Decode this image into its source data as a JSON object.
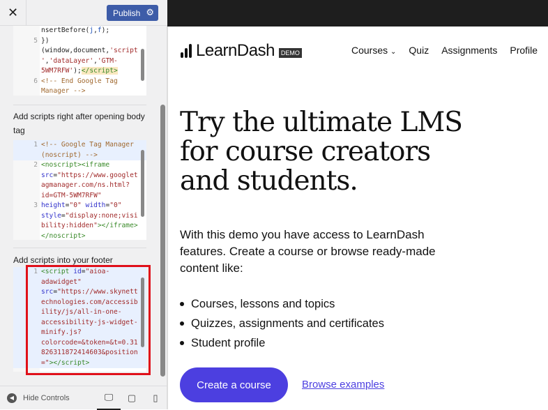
{
  "customizer": {
    "close_icon": "close-icon",
    "publish_label": "Publish",
    "sections": [
      {
        "label": ""
      },
      {
        "label": "Add scripts right after opening body tag"
      },
      {
        "label": "Add scripts into your footer"
      }
    ],
    "code_blocks": [
      {
        "rows": [
          {
            "ln": "",
            "hl": false,
            "t": [
              [
                "nsertBefore(",
                "df"
              ],
              [
                "j",
                "vr"
              ],
              [
                ",",
                "df"
              ],
              [
                "f",
                "vr"
              ],
              [
                ");",
                "df"
              ]
            ]
          },
          {
            "ln": "5",
            "hl": false,
            "t": [
              [
                "})",
                "df"
              ]
            ]
          },
          {
            "ln": "",
            "hl": false,
            "t": [
              [
                "(window,document,",
                "df"
              ],
              [
                "'script",
                "st"
              ]
            ]
          },
          {
            "ln": "",
            "hl": false,
            "t": [
              [
                "'",
                "st"
              ],
              [
                ",",
                "df"
              ],
              [
                "'dataLayer'",
                "st"
              ],
              [
                ",",
                "df"
              ],
              [
                "'GTM-",
                "st"
              ]
            ]
          },
          {
            "ln": "",
            "hl": false,
            "t": [
              [
                "5WM7RFW'",
                "st"
              ],
              [
                ");",
                "df"
              ],
              [
                "</script>",
                "mt"
              ]
            ]
          },
          {
            "ln": "6",
            "hl": false,
            "t": [
              [
                "<!-- End Google Tag",
                "cm"
              ]
            ]
          },
          {
            "ln": "",
            "hl": false,
            "t": [
              [
                "Manager -->",
                "cm"
              ]
            ]
          }
        ]
      },
      {
        "rows": [
          {
            "ln": "1",
            "hl": true,
            "t": [
              [
                "<!-- Google Tag Manager",
                "cm"
              ]
            ]
          },
          {
            "ln": "",
            "hl": true,
            "t": [
              [
                "(noscript) -->",
                "cm"
              ]
            ]
          },
          {
            "ln": "2",
            "hl": false,
            "t": [
              [
                "<noscript><iframe",
                "tg"
              ]
            ]
          },
          {
            "ln": "",
            "hl": false,
            "t": [
              [
                "src",
                "at"
              ],
              [
                "=",
                "df"
              ],
              [
                "\"https://www.googlet",
                "st"
              ]
            ]
          },
          {
            "ln": "",
            "hl": false,
            "t": [
              [
                "agmanager.com/ns.html?",
                "st"
              ]
            ]
          },
          {
            "ln": "",
            "hl": false,
            "t": [
              [
                "id=GTM-5WM7RFW\"",
                "st"
              ]
            ]
          },
          {
            "ln": "3",
            "hl": false,
            "t": [
              [
                "height",
                "at"
              ],
              [
                "=",
                "df"
              ],
              [
                "\"0\"",
                "st"
              ],
              [
                " ",
                "df"
              ],
              [
                "width",
                "at"
              ],
              [
                "=",
                "df"
              ],
              [
                "\"0\"",
                "st"
              ]
            ]
          },
          {
            "ln": "",
            "hl": false,
            "t": [
              [
                "style",
                "at"
              ],
              [
                "=",
                "df"
              ],
              [
                "\"display:none;visi",
                "st"
              ]
            ]
          },
          {
            "ln": "",
            "hl": false,
            "t": [
              [
                "bility:hidden\"",
                "st"
              ],
              [
                "></iframe>",
                "tg"
              ]
            ]
          },
          {
            "ln": "",
            "hl": false,
            "t": [
              [
                "</noscript>",
                "tg"
              ]
            ]
          }
        ]
      },
      {
        "rows": [
          {
            "ln": "1",
            "hl": true,
            "t": [
              [
                "<script ",
                "tg"
              ],
              [
                "id",
                "at"
              ],
              [
                "=",
                "df"
              ],
              [
                "\"aioa-",
                "st"
              ]
            ]
          },
          {
            "ln": "",
            "hl": true,
            "t": [
              [
                "adawidget\"",
                "st"
              ]
            ]
          },
          {
            "ln": "",
            "hl": true,
            "t": [
              [
                "src",
                "at"
              ],
              [
                "=",
                "df"
              ],
              [
                "\"https://www.skynett",
                "st"
              ]
            ]
          },
          {
            "ln": "",
            "hl": true,
            "t": [
              [
                "echnologies.com/accessib",
                "st"
              ]
            ]
          },
          {
            "ln": "",
            "hl": true,
            "t": [
              [
                "ility/js/all-in-one-",
                "st"
              ]
            ]
          },
          {
            "ln": "",
            "hl": true,
            "t": [
              [
                "accessibility-js-widget-",
                "st"
              ]
            ]
          },
          {
            "ln": "",
            "hl": true,
            "t": [
              [
                "minify.js?",
                "st"
              ]
            ]
          },
          {
            "ln": "",
            "hl": true,
            "t": [
              [
                "colorcode=&token=&t=0.31",
                "st"
              ]
            ]
          },
          {
            "ln": "",
            "hl": true,
            "t": [
              [
                "826311872414603&position",
                "st"
              ]
            ]
          },
          {
            "ln": "",
            "hl": true,
            "t": [
              [
                "=\"",
                "st"
              ],
              [
                "></script>",
                "tg"
              ]
            ]
          }
        ]
      }
    ],
    "hide_controls_label": "Hide Controls",
    "devices": [
      "desktop",
      "tablet",
      "mobile"
    ]
  },
  "site": {
    "logo_text": "LearnDash",
    "logo_badge": "DEMO",
    "nav": [
      "Courses",
      "Quiz",
      "Assignments",
      "Profile"
    ],
    "hero_title": "Try the ultimate LMS for course creators and students.",
    "intro": "With this demo you have access to LearnDash features. Create a course or browse ready-made content like:",
    "bullets": [
      "Courses, lessons and topics",
      "Quizzes, assignments and certificates",
      "Student profile"
    ],
    "cta_label": "Create a course",
    "link_label": "Browse examples",
    "accent": "#4c3fe0"
  }
}
